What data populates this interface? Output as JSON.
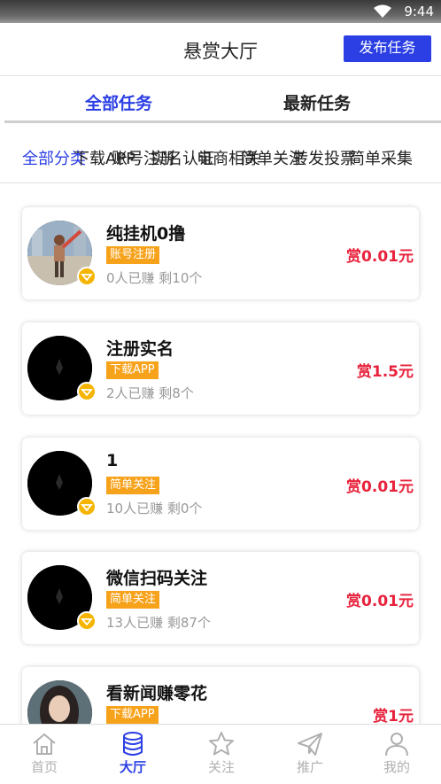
{
  "status": {
    "time": "9:44"
  },
  "header": {
    "title": "悬赏大厅",
    "publish_label": "发布任务"
  },
  "tabs": [
    {
      "label": "全部任务",
      "active": true
    },
    {
      "label": "最新任务",
      "active": false
    }
  ],
  "categories": [
    {
      "label": "全部分类",
      "active": true
    },
    {
      "label": "下载APP"
    },
    {
      "label": "账号注册"
    },
    {
      "label": "实名认证"
    },
    {
      "label": "电商相关"
    },
    {
      "label": "简单关注"
    },
    {
      "label": "转发投票"
    },
    {
      "label": "简单采集"
    }
  ],
  "tasks": [
    {
      "name": "纯挂机0撸",
      "tag": "账号注册",
      "stats": "0人已赚 剩10个",
      "reward": "赏0.01元",
      "avatar": "photo"
    },
    {
      "name": "注册实名",
      "tag": "下载APP",
      "stats": "2人已赚 剩8个",
      "reward": "赏1.5元",
      "avatar": "dark"
    },
    {
      "name": "1",
      "tag": "简单关注",
      "stats": "10人已赚 剩0个",
      "reward": "赏0.01元",
      "avatar": "dark"
    },
    {
      "name": "微信扫码关注",
      "tag": "简单关注",
      "stats": "13人已赚 剩87个",
      "reward": "赏0.01元",
      "avatar": "dark"
    },
    {
      "name": "看新闻赚零花",
      "tag": "下载APP",
      "stats": "",
      "reward": "赏1元",
      "avatar": "woman"
    }
  ],
  "nav": [
    {
      "label": "首页",
      "icon": "home-icon",
      "active": false
    },
    {
      "label": "大厅",
      "icon": "database-icon",
      "active": true
    },
    {
      "label": "关注",
      "icon": "star-icon",
      "active": false
    },
    {
      "label": "推广",
      "icon": "paper-plane-icon",
      "active": false
    },
    {
      "label": "我的",
      "icon": "user-icon",
      "active": false
    }
  ],
  "colors": {
    "accent": "#2b3fe4",
    "reward": "#e8223c",
    "tag": "#f7a21b",
    "vip": "#f5b400"
  }
}
